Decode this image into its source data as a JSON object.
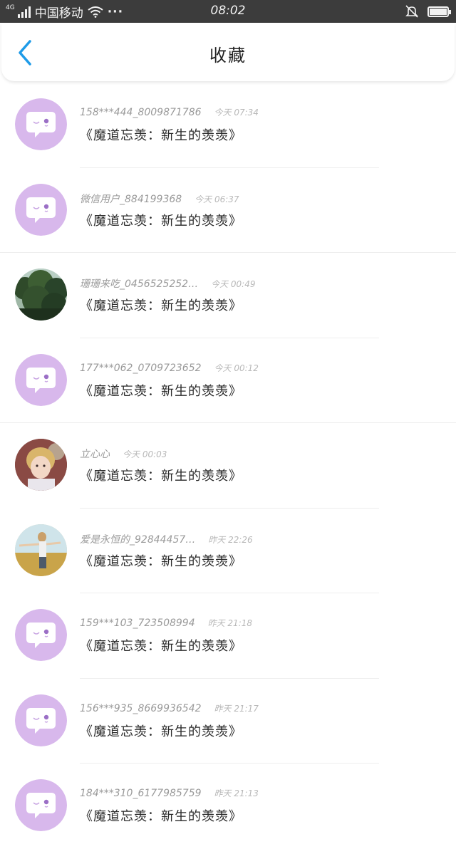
{
  "status_bar": {
    "network": "4G",
    "carrier": "中国移动",
    "more": "···",
    "time": "08:02"
  },
  "header": {
    "title": "收藏"
  },
  "items": [
    {
      "user": "158***444_8009871786",
      "time": "今天 07:34",
      "title": "《魔道忘羡：新生的羡羡》",
      "avatar": "default-chat-avatar"
    },
    {
      "user": "微信用户_884199368",
      "time": "今天 06:37",
      "title": "《魔道忘羡：新生的羡羡》",
      "avatar": "default-chat-avatar"
    },
    {
      "user": "珊珊来吃_0456525252…",
      "time": "今天 00:49",
      "title": "《魔道忘羡：新生的羡羡》",
      "avatar": "trees-photo"
    },
    {
      "user": "177***062_0709723652",
      "time": "今天 00:12",
      "title": "《魔道忘羡：新生的羡羡》",
      "avatar": "default-chat-avatar"
    },
    {
      "user": "立心心",
      "time": "今天 00:03",
      "title": "《魔道忘羡：新生的羡羡》",
      "avatar": "girl-portrait"
    },
    {
      "user": "爱是永恒的_92844457…",
      "time": "昨天 22:26",
      "title": "《魔道忘羡：新生的羡羡》",
      "avatar": "girl-field-photo"
    },
    {
      "user": "159***103_723508994",
      "time": "昨天 21:18",
      "title": "《魔道忘羡：新生的羡羡》",
      "avatar": "default-chat-avatar"
    },
    {
      "user": "156***935_8669936542",
      "time": "昨天 21:17",
      "title": "《魔道忘羡：新生的羡羡》",
      "avatar": "default-chat-avatar"
    },
    {
      "user": "184***310_6177985759",
      "time": "昨天 21:13",
      "title": "《魔道忘羡：新生的羡羡》",
      "avatar": "default-chat-avatar"
    }
  ],
  "colors": {
    "status_bar_bg": "#3c3c3c",
    "accent_back": "#1e9be8",
    "default_avatar": "#d8b8ec"
  }
}
